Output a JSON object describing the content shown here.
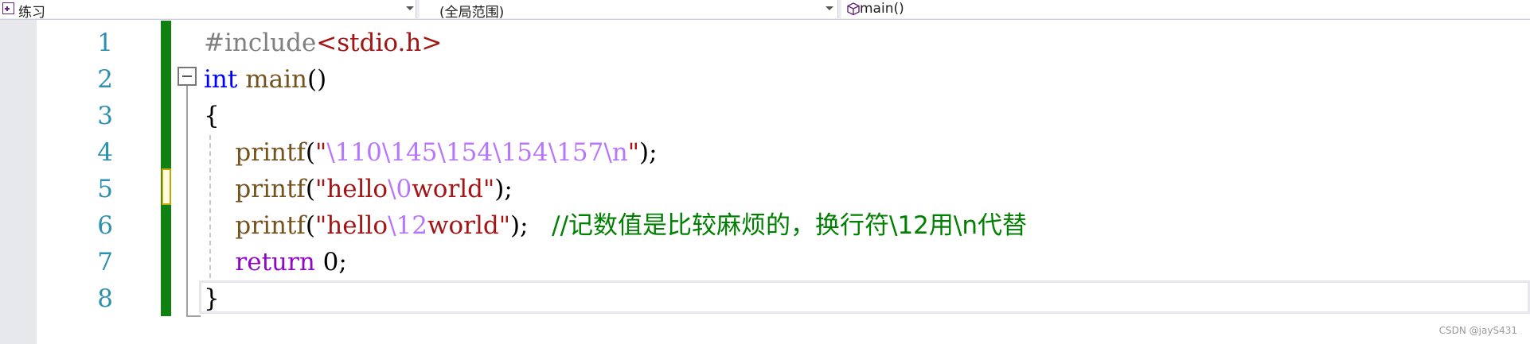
{
  "navbar": {
    "project": "练习",
    "scope": "(全局范围)",
    "member": "main()"
  },
  "editor": {
    "line_numbers": [
      "1",
      "2",
      "3",
      "4",
      "5",
      "6",
      "7",
      "8"
    ],
    "lines": [
      [
        {
          "t": "#include",
          "c": "pre"
        },
        {
          "t": "<stdio.h>",
          "c": "inc"
        }
      ],
      [
        {
          "t": "int",
          "c": "kw"
        },
        {
          "t": " ",
          "c": "plain"
        },
        {
          "t": "main",
          "c": "fn"
        },
        {
          "t": "()",
          "c": "plain"
        }
      ],
      [
        {
          "t": "{",
          "c": "plain"
        }
      ],
      [
        {
          "t": "    ",
          "c": "plain"
        },
        {
          "t": "printf",
          "c": "fn"
        },
        {
          "t": "(",
          "c": "plain"
        },
        {
          "t": "\"",
          "c": "str"
        },
        {
          "t": "\\110\\145\\154\\154\\157\\n",
          "c": "esc"
        },
        {
          "t": "\"",
          "c": "str"
        },
        {
          "t": ");",
          "c": "plain"
        }
      ],
      [
        {
          "t": "    ",
          "c": "plain"
        },
        {
          "t": "printf",
          "c": "fn"
        },
        {
          "t": "(",
          "c": "plain"
        },
        {
          "t": "\"hello",
          "c": "str"
        },
        {
          "t": "\\0",
          "c": "esc"
        },
        {
          "t": "world\"",
          "c": "str"
        },
        {
          "t": ");",
          "c": "plain"
        }
      ],
      [
        {
          "t": "    ",
          "c": "plain"
        },
        {
          "t": "printf",
          "c": "fn"
        },
        {
          "t": "(",
          "c": "plain"
        },
        {
          "t": "\"hello",
          "c": "str"
        },
        {
          "t": "\\12",
          "c": "esc"
        },
        {
          "t": "world\"",
          "c": "str"
        },
        {
          "t": ");   ",
          "c": "plain"
        },
        {
          "t": "//记数值是比较麻烦的，换行符\\12用\\n代替",
          "c": "cmt"
        }
      ],
      [
        {
          "t": "    ",
          "c": "plain"
        },
        {
          "t": "return",
          "c": "ctl"
        },
        {
          "t": " ",
          "c": "plain"
        },
        {
          "t": "0",
          "c": "num"
        },
        {
          "t": ";",
          "c": "plain"
        }
      ],
      [
        {
          "t": "}",
          "c": "plain"
        }
      ]
    ]
  },
  "watermark": "CSDN @jayS431",
  "colors": {
    "line_number": "#2b91af",
    "keyword": "#0000ff",
    "function": "#74531f",
    "string": "#a31515",
    "escape": "#b776fb",
    "control": "#8f08c4",
    "comment": "#008000",
    "change_bar": "#108010"
  },
  "icons": {
    "project": "project-icon",
    "member": "cube-icon",
    "collapse": "collapse-minus-icon"
  }
}
